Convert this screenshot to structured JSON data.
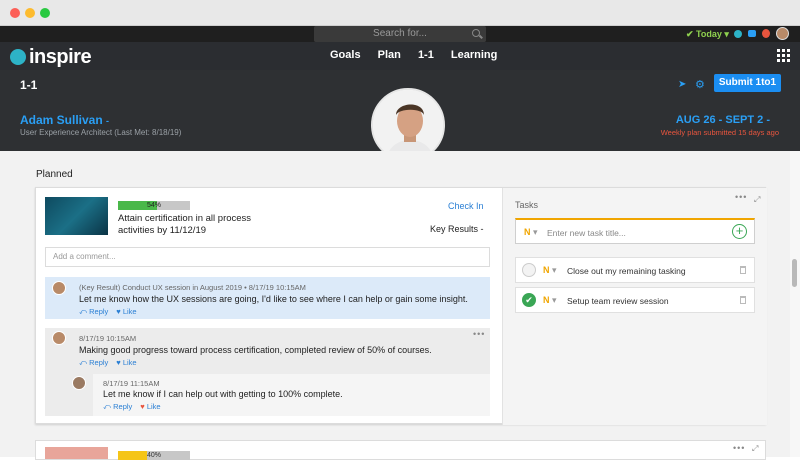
{
  "window": {
    "controls": [
      "close",
      "minimize",
      "zoom"
    ],
    "colors": {
      "close": "#fc5f57",
      "minimize": "#fdbb2e",
      "zoom": "#29c941"
    }
  },
  "topbar": {
    "search_placeholder": "Search for...",
    "status": "Today"
  },
  "nav": {
    "logo": "inspire",
    "links": [
      "Goals",
      "Plan",
      "1-1",
      "Learning"
    ]
  },
  "header": {
    "page_title": "1-1",
    "submit_label": "Submit 1to1",
    "person_name": "Adam Sullivan",
    "person_role": "User Experience Architect (Last Met: 8/18/19)",
    "date_range": "AUG 26 - SEPT 2",
    "submitted_note": "Weekly plan submitted 15 days ago"
  },
  "planned": {
    "section_title": "Planned",
    "goal": {
      "progress_label": "54%",
      "progress": 0.54,
      "title": "Attain certification in all process activities by 11/12/19",
      "check_in": "Check In",
      "key_results": "Key Results"
    },
    "comment_placeholder": "Add a comment...",
    "comments": [
      {
        "meta": "(Key Result) Conduct UX session in August 2019 • 8/17/19 10:15AM",
        "text": "Let me know how the UX sessions are going, I'd like to see where I can help or gain some insight.",
        "reply": "Reply",
        "like": "Like"
      },
      {
        "meta": "8/17/19 10:15AM",
        "text": "Making good progress toward process certification, completed review of 50% of courses.",
        "reply": "Reply",
        "like": "Like"
      },
      {
        "meta": "8/17/19 11:15AM",
        "text": "Let me know if I can help out with getting to 100% complete.",
        "reply": "Reply",
        "like": "Like"
      }
    ]
  },
  "tasks": {
    "title": "Tasks",
    "priority": "N",
    "input_placeholder": "Enter new task title...",
    "items": [
      {
        "label": "Close out my remaining tasking",
        "done": false
      },
      {
        "label": "Setup team review session",
        "done": true
      }
    ]
  },
  "next_card": {
    "progress_label": "40%"
  },
  "colors": {
    "accent": "#1b8ef2",
    "success": "#4ab84a",
    "priority": "#f0a500",
    "alert": "#e8553e"
  }
}
